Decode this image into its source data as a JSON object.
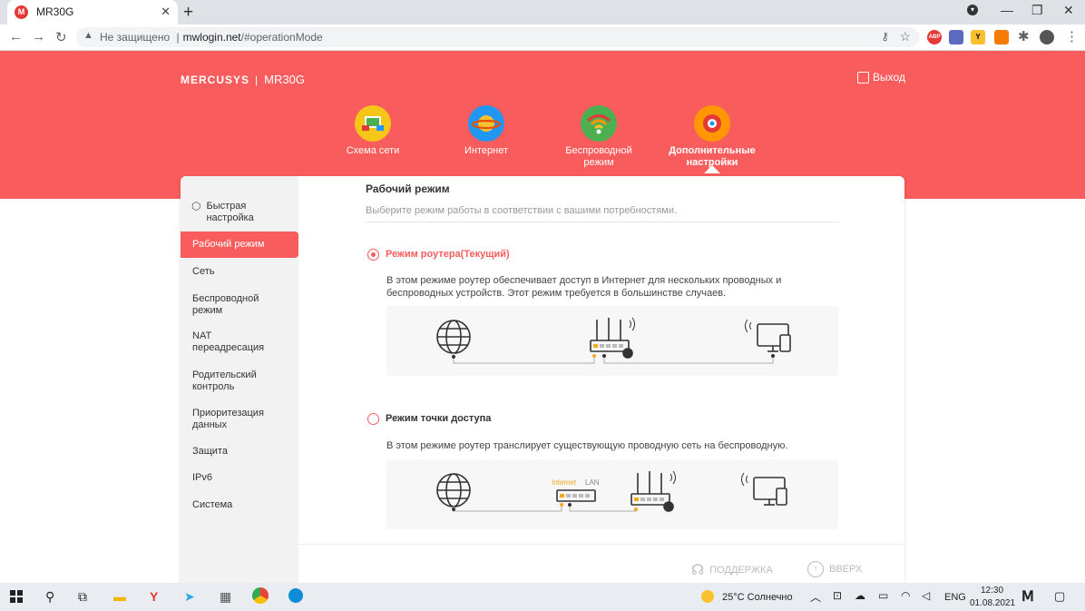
{
  "browser": {
    "tab_title": "MR30G",
    "tab_favicon": "M",
    "address_security": "Не защищено",
    "address_separator": "|",
    "address_domain": "mwlogin.net",
    "address_path": "/#operationMode",
    "extension_abp": "ABP",
    "extension_y": "Y"
  },
  "header": {
    "brand": "MERCUSYS",
    "separator": "|",
    "model": "MR30G",
    "logout_label": "Выход",
    "nav": [
      {
        "label": "Схема сети",
        "icon": "network-map-icon",
        "color": "#f5c518"
      },
      {
        "label": "Интернет",
        "icon": "planet-icon",
        "color": "#2196f3"
      },
      {
        "label": "Беспроводной режим",
        "icon": "wifi-icon",
        "color": "#4caf50"
      },
      {
        "label": "Дополнительные настройки",
        "icon": "advanced-gear-icon",
        "color": "#ff9800"
      }
    ]
  },
  "sidebar": {
    "items": [
      {
        "label": "Быстрая настройка",
        "icon": "quick-setup-icon"
      },
      {
        "label": "Рабочий режим",
        "active": true
      },
      {
        "label": "Сеть"
      },
      {
        "label": "Беспроводной режим"
      },
      {
        "label": "NAT переадресация"
      },
      {
        "label": "Родительский контроль"
      },
      {
        "label": "Приоритезация данных"
      },
      {
        "label": "Защита"
      },
      {
        "label": "IPv6"
      },
      {
        "label": "Система"
      }
    ]
  },
  "main": {
    "title": "Рабочий режим",
    "subtitle": "Выберите режим работы в соответствии с вашими потребностями.",
    "modes": [
      {
        "label": "Режим роутера(Текущий)",
        "selected": true,
        "description_line1": "В этом режиме роутер обеспечивает доступ в Интернет для нескольких проводных и",
        "description_line2": "беспроводных устройств. Этот режим требуется в большинстве случаев."
      },
      {
        "label": "Режим точки доступа",
        "selected": false,
        "description_line1": "В этом режиме роутер транслирует существующую проводную сеть на беспроводную.",
        "diagram_internet_label": "Internet",
        "diagram_lan_label": "LAN"
      }
    ]
  },
  "footer": {
    "support_label": "ПОДДЕРЖКА",
    "top_label": "ВВЕРХ"
  },
  "taskbar": {
    "weather": "25°C Солнечно",
    "language": "ENG",
    "time": "12:30",
    "date": "01.08.2021"
  },
  "colors": {
    "accent": "#f85c5c",
    "muted": "#999999",
    "ap_internet": "#f5a623"
  }
}
